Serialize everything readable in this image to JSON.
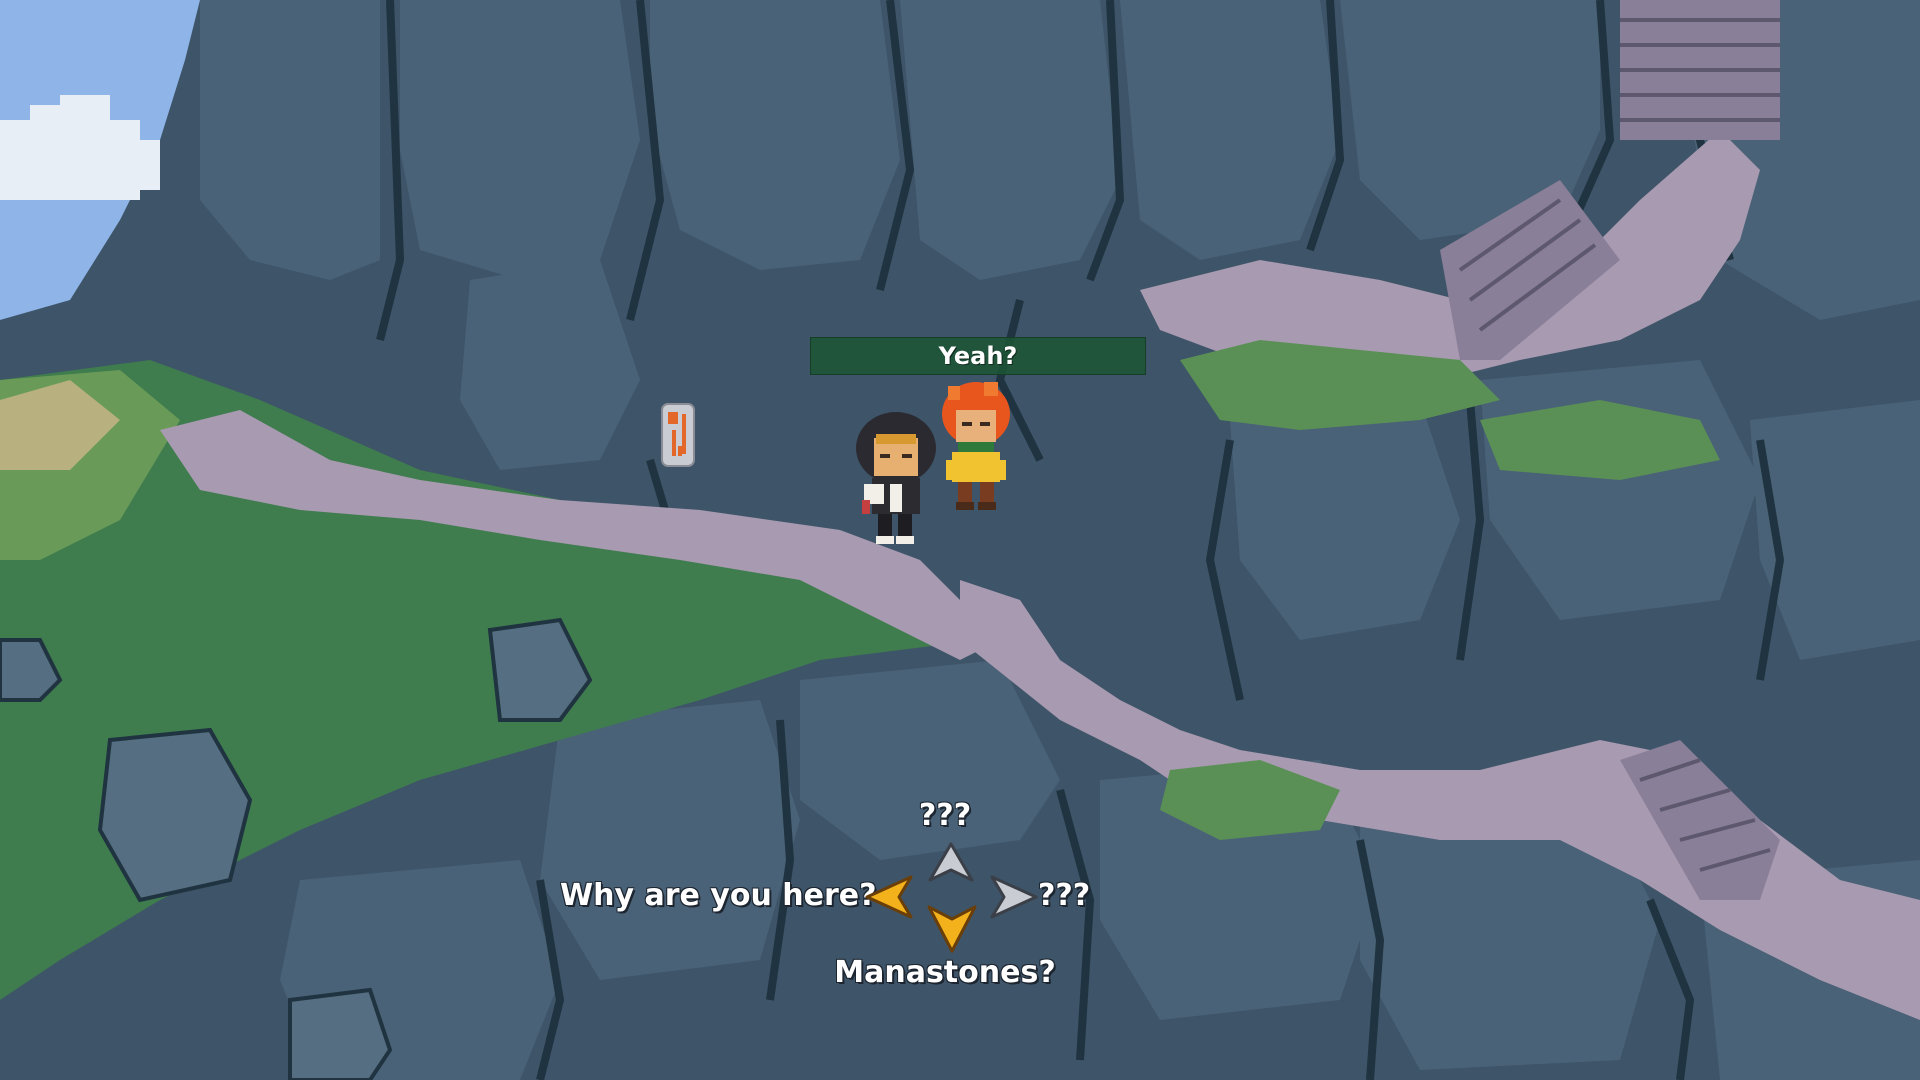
{
  "scene": {
    "name": "Cliffside Path",
    "colors": {
      "sky": "#8eb4e8",
      "rock_base": "#3e5468",
      "rock_face": "#4a6277",
      "rock_crack": "#1f3440",
      "path": "#a89ab0",
      "grass_dark": "#3f7c4e",
      "grass_light": "#6a9a58",
      "cloud": "#e8eef6"
    }
  },
  "speech_bubble": {
    "text": "Yeah?",
    "background": "#1c5434"
  },
  "dialogue_choices": {
    "up": {
      "label": "???",
      "arrow_state": "inactive"
    },
    "left": {
      "label": "Why are you here?",
      "arrow_state": "active"
    },
    "right": {
      "label": "???",
      "arrow_state": "inactive"
    },
    "down": {
      "label": "Manastones?",
      "arrow_state": "active"
    },
    "active_color": "#f3b21b",
    "inactive_color": "#c9ccd2"
  },
  "icons": {
    "signpost": "orange-rune-sign-icon",
    "arrow_up": "chevron-up-icon",
    "arrow_left": "chevron-left-icon",
    "arrow_right": "chevron-right-icon",
    "arrow_down": "chevron-down-icon"
  }
}
